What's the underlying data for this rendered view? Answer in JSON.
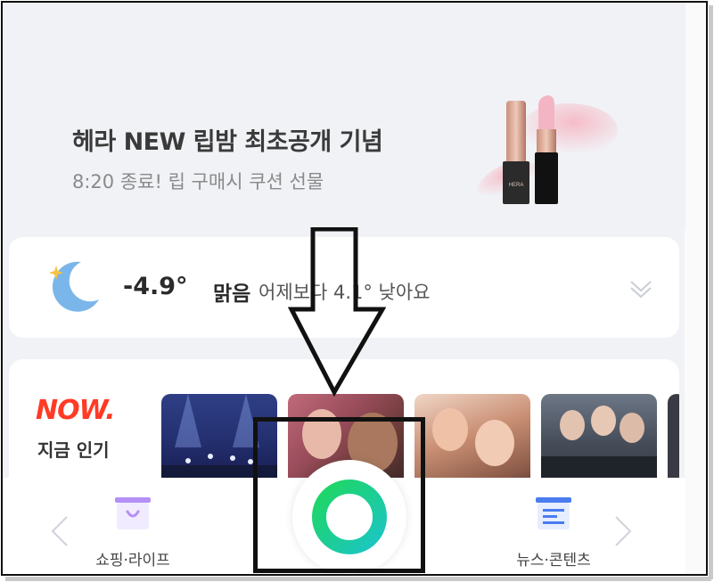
{
  "ad": {
    "title": "헤라 NEW 립밤 최초공개 기념",
    "subtitle": "8:20 종료! 립 구매시 쿠션 선물",
    "product_brand": "HERA"
  },
  "weather": {
    "temperature": "-4.9°",
    "condition": "맑음",
    "comparison": "어제보다 4.1° 낮아요",
    "icon": "moon-star-icon"
  },
  "now": {
    "logo": "NOW.",
    "label": "지금 인기",
    "thumbnails": [
      "concert-stage",
      "drama-poster",
      "show-thumbnail",
      "group-photo",
      "partial-thumbnail"
    ]
  },
  "bottom_nav": {
    "shopping_label": "쇼핑·라이프",
    "news_label": "뉴스·콘텐츠",
    "center_button": "green-circle-button"
  },
  "colors": {
    "background": "#f1f2f6",
    "now_red": "#ff3b25",
    "green_start": "#1ed760",
    "green_end": "#1cc5c5",
    "shopping_accent": "#b48ff5",
    "news_accent": "#4a7cf0"
  }
}
